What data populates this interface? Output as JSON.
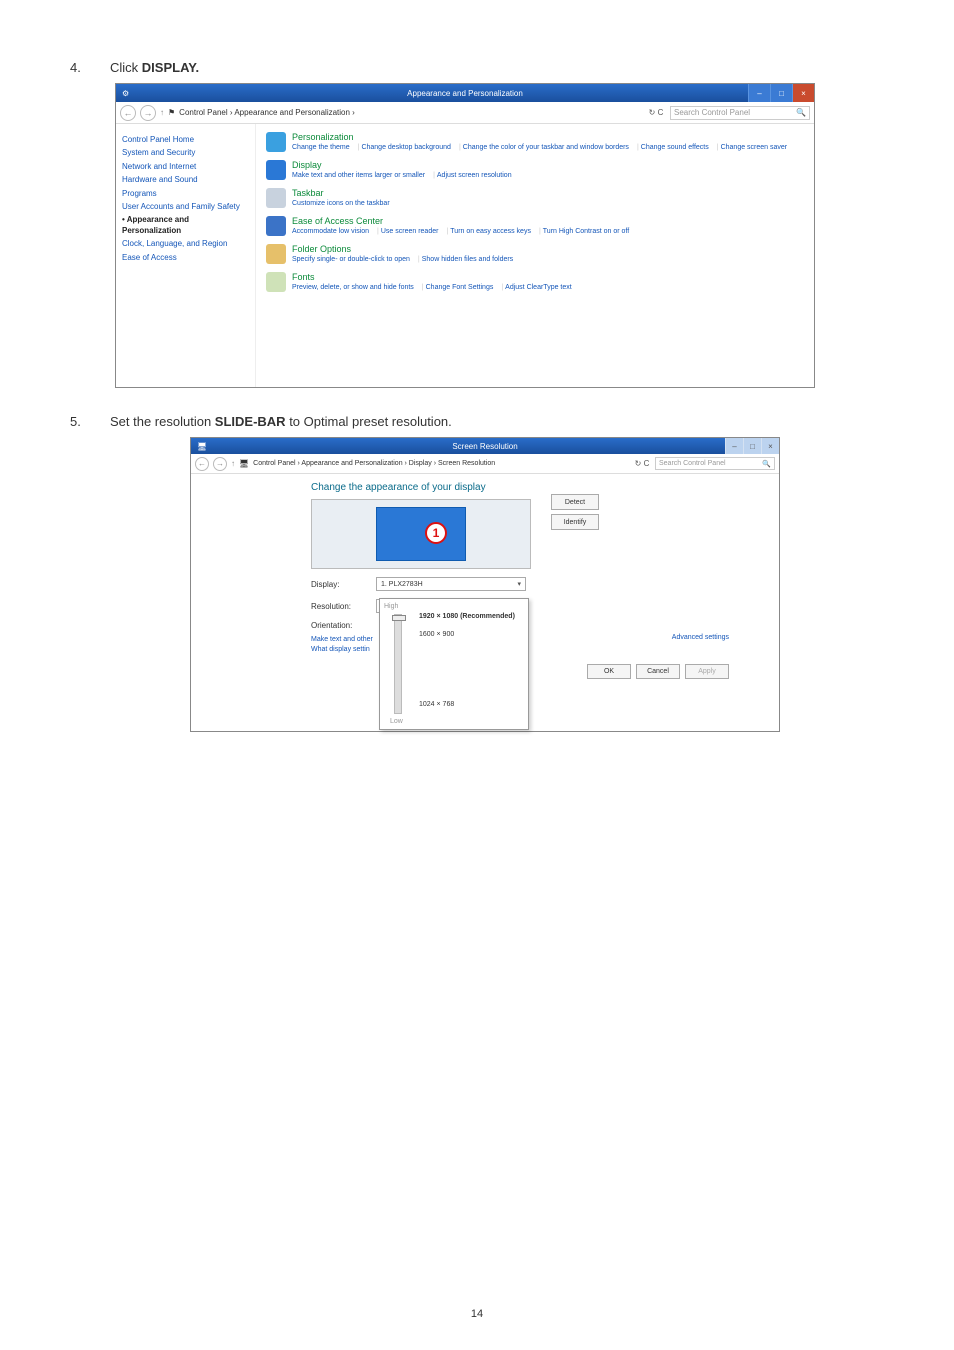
{
  "page_number": "14",
  "steps": [
    {
      "num": "4.",
      "html_pre": "Click ",
      "bold": "DISPLAY.",
      "html_post": ""
    },
    {
      "num": "5.",
      "html_pre": "Set the resolution ",
      "bold": "SLIDE-BAR",
      "html_post": " to Optimal preset resolution."
    }
  ],
  "s1": {
    "window_title": "Appearance and Personalization",
    "breadcrumb": "Control Panel  ›  Appearance and Personalization  ›",
    "refresh_label": "↻ C",
    "search_placeholder": "Search Control Panel",
    "sidebar": [
      "Control Panel Home",
      "System and Security",
      "Network and Internet",
      "Hardware and Sound",
      "Programs",
      "User Accounts and Family Safety",
      "Appearance and Personalization",
      "Clock, Language, and Region",
      "Ease of Access"
    ],
    "sidebar_active_index": 6,
    "categories": [
      {
        "title": "Personalization",
        "icon_color": "#3aa0e0",
        "links": [
          "Change the theme",
          "Change desktop background",
          "Change the color of your taskbar and window borders",
          "Change sound effects",
          "Change screen saver"
        ]
      },
      {
        "title": "Display",
        "icon_color": "#2a78d6",
        "links": [
          "Make text and other items larger or smaller",
          "Adjust screen resolution"
        ]
      },
      {
        "title": "Taskbar",
        "icon_color": "#c8d2de",
        "links": [
          "Customize icons on the taskbar"
        ]
      },
      {
        "title": "Ease of Access Center",
        "icon_color": "#3b73c7",
        "links": [
          "Accommodate low vision",
          "Use screen reader",
          "Turn on easy access keys",
          "Turn High Contrast on or off"
        ]
      },
      {
        "title": "Folder Options",
        "icon_color": "#e6c06a",
        "links": [
          "Specify single- or double-click to open",
          "Show hidden files and folders"
        ]
      },
      {
        "title": "Fonts",
        "icon_color": "#cfe2b8",
        "links": [
          "Preview, delete, or show and hide fonts",
          "Change Font Settings",
          "Adjust ClearType text"
        ]
      }
    ]
  },
  "s2": {
    "window_title": "Screen Resolution",
    "breadcrumb": "Control Panel  ›  Appearance and Personalization  ›  Display  ›  Screen Resolution",
    "refresh_label": "↻ C",
    "search_placeholder": "Search Control Panel",
    "heading": "Change the appearance of your display",
    "callout_num": "1",
    "detect_btn": "Detect",
    "identify_btn": "Identify",
    "rows": {
      "display_label": "Display:",
      "display_value": "1. PLX2783H",
      "resolution_label": "Resolution:",
      "resolution_value": "1920 × 1080 (Recommended)",
      "orientation_label": "Orientation:"
    },
    "dropdown": {
      "high": "High",
      "opt1": "1920 × 1080 (Recommended)",
      "opt2": "1600 × 900",
      "opt3": "1024 × 768",
      "low": "Low"
    },
    "link1": "Make text and other",
    "link2": "What display settin",
    "advanced": "Advanced settings",
    "ok": "OK",
    "cancel": "Cancel",
    "apply": "Apply"
  }
}
